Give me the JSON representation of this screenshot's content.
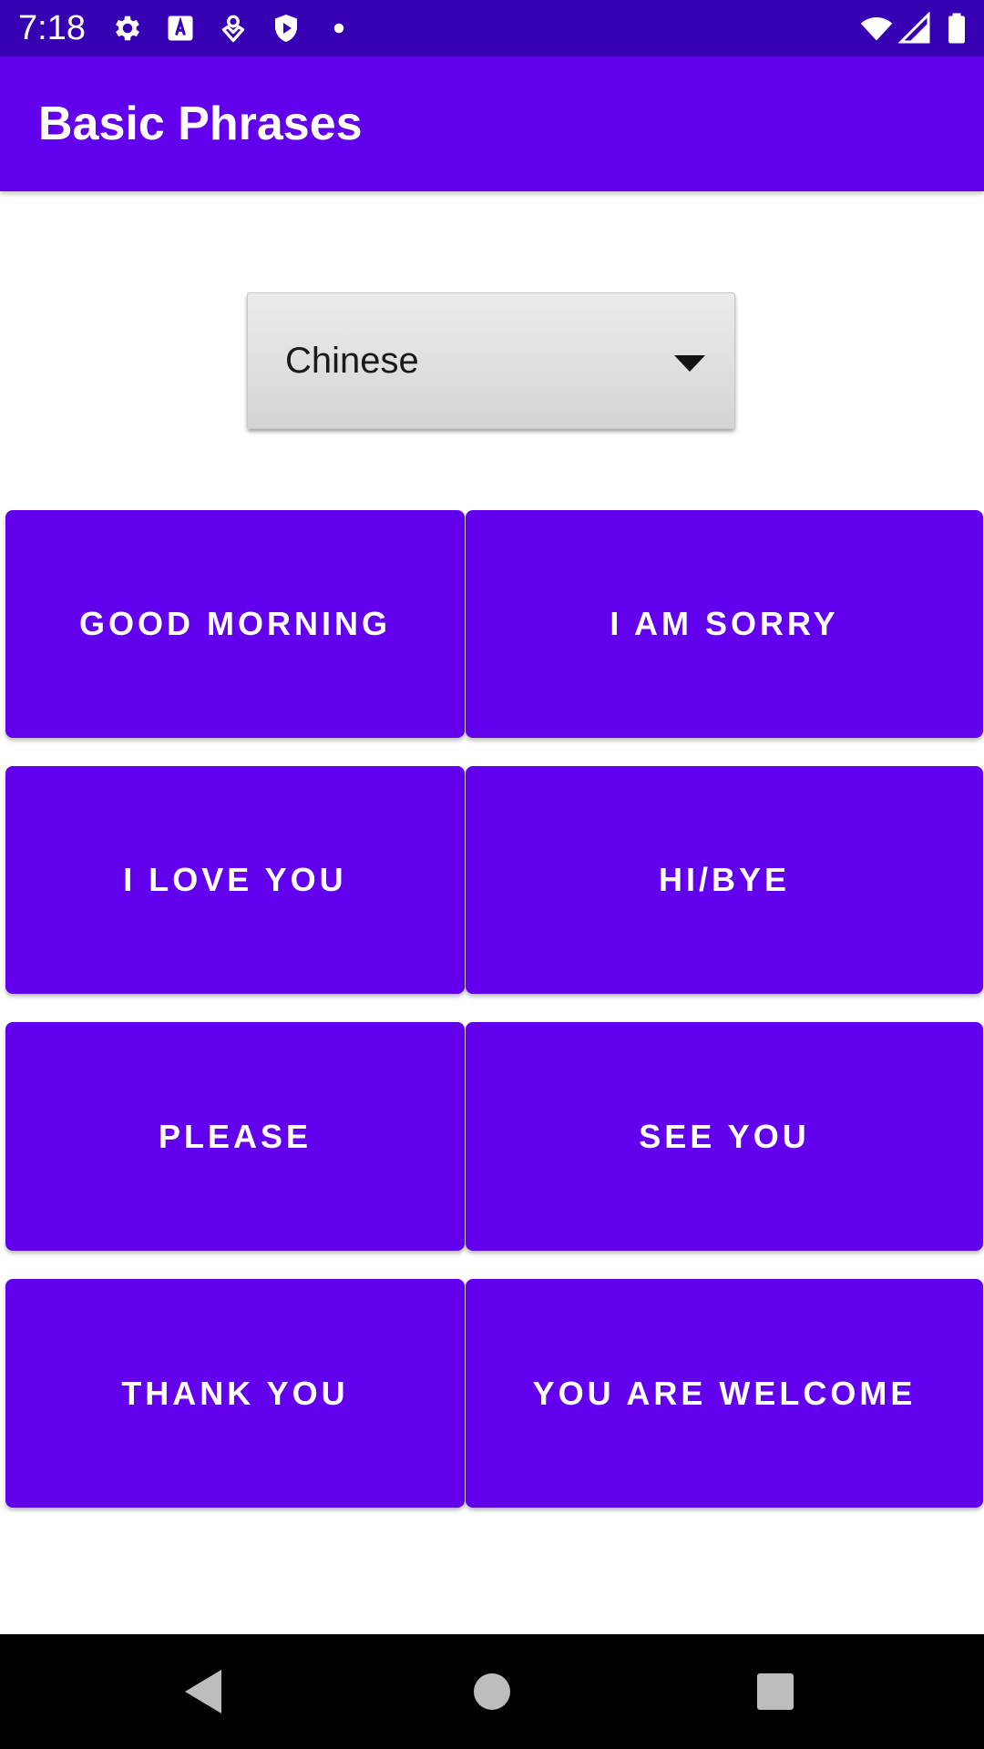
{
  "status_bar": {
    "time": "7:18",
    "icons": [
      "gear-icon",
      "text-a-icon",
      "location-icon",
      "shield-play-icon",
      "dot-icon",
      "wifi-icon",
      "signal-icon",
      "battery-icon"
    ]
  },
  "app_bar": {
    "title": "Basic Phrases"
  },
  "language_spinner": {
    "selected": "Chinese"
  },
  "phrases": [
    "GOOD MORNING",
    "I AM SORRY",
    "I LOVE YOU",
    "HI/BYE",
    "PLEASE",
    "SEE YOU",
    "THANK YOU",
    "YOU ARE WELCOME"
  ],
  "nav_bar": {
    "icons": [
      "back-icon",
      "home-icon",
      "recents-icon"
    ]
  },
  "colors": {
    "status_bar": "#3700b3",
    "primary": "#6200ee",
    "background": "#ffffff",
    "nav_bar": "#000000"
  }
}
